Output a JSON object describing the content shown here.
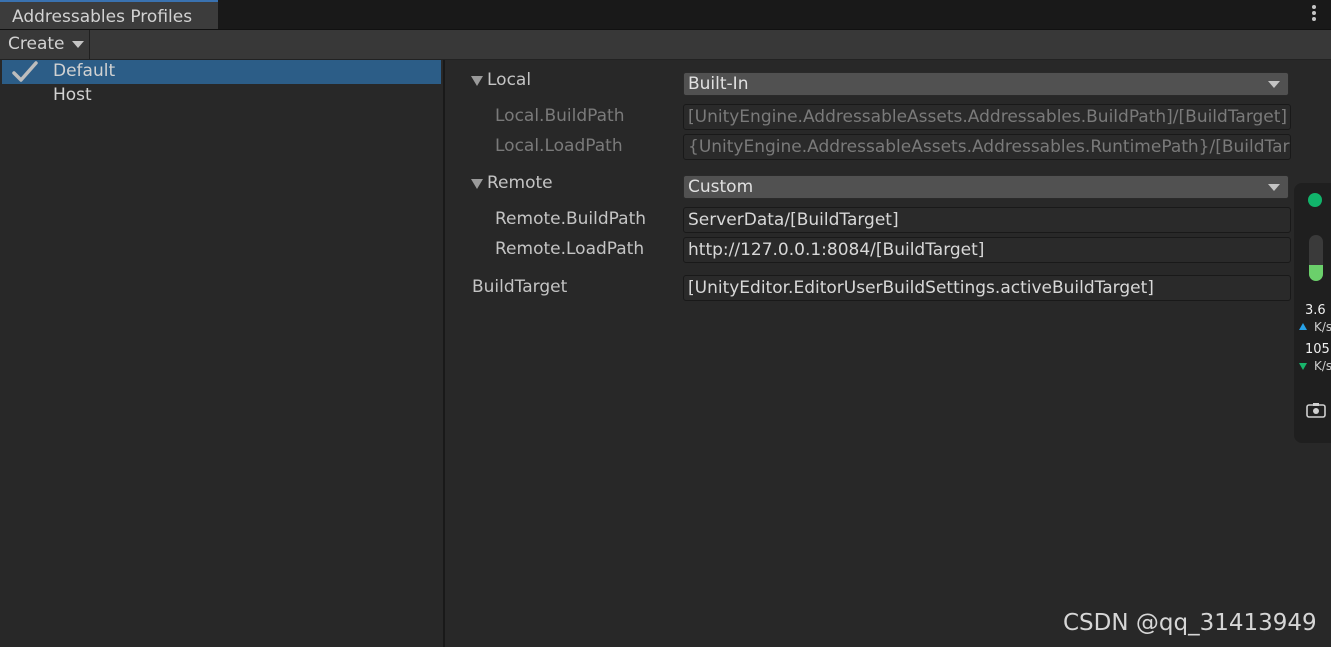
{
  "window": {
    "tab_title": "Addressables Profiles"
  },
  "toolbar": {
    "create_label": "Create"
  },
  "profiles": [
    {
      "label": "Default",
      "selected": true
    },
    {
      "label": "Host",
      "selected": false
    }
  ],
  "variables": {
    "local": {
      "label": "Local",
      "mode": "Built-In",
      "build_path_label": "Local.BuildPath",
      "build_path_value": "[UnityEngine.AddressableAssets.Addressables.BuildPath]/[BuildTarget]",
      "load_path_label": "Local.LoadPath",
      "load_path_value": "{UnityEngine.AddressableAssets.Addressables.RuntimePath}/[BuildTarget]"
    },
    "remote": {
      "label": "Remote",
      "mode": "Custom",
      "build_path_label": "Remote.BuildPath",
      "build_path_value": "ServerData/[BuildTarget]",
      "load_path_label": "Remote.LoadPath",
      "load_path_value": "http://127.0.0.1:8084/[BuildTarget]"
    },
    "build_target": {
      "label": "BuildTarget",
      "value": "[UnityEditor.EditorUserBuildSettings.activeBuildTarget]"
    }
  },
  "net_widget": {
    "upload_rate": "3.6",
    "upload_unit": "K/s",
    "download_rate": "105",
    "download_unit": "K/s",
    "status_color": "#11b46b",
    "level": 0.35,
    "icons": [
      "status-dot-icon",
      "level-gauge-icon",
      "upload-arrow-icon",
      "download-arrow-icon",
      "camera-icon"
    ]
  },
  "watermark": "CSDN @qq_31413949",
  "colors": {
    "selection": "#2c5d87",
    "tab_accent": "#3a72b0"
  }
}
